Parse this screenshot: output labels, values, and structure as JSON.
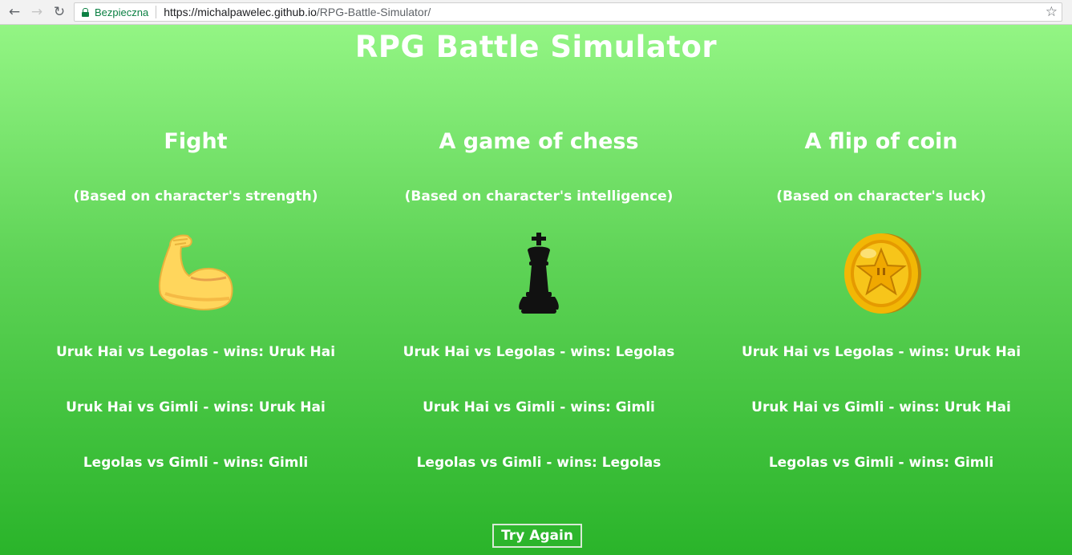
{
  "browser": {
    "secure_label": "Bezpieczna",
    "url_host": "https://michalpawelec.github.io",
    "url_path": "/RPG-Battle-Simulator/"
  },
  "page": {
    "title": "RPG Battle Simulator",
    "columns": [
      {
        "title": "Fight",
        "subtitle": "(Based on character's strength)",
        "icon": "flexed-biceps-icon",
        "results": [
          "Uruk Hai vs Legolas - wins: Uruk Hai",
          "Uruk Hai vs Gimli - wins: Uruk Hai",
          "Legolas vs Gimli - wins: Gimli"
        ]
      },
      {
        "title": "A game of chess",
        "subtitle": "(Based on character's intelligence)",
        "icon": "chess-king-icon",
        "results": [
          "Uruk Hai vs Legolas - wins: Legolas",
          "Uruk Hai vs Gimli - wins: Gimli",
          "Legolas vs Gimli - wins: Legolas"
        ]
      },
      {
        "title": "A flip of coin",
        "subtitle": "(Based on character's luck)",
        "icon": "gold-coin-icon",
        "results": [
          "Uruk Hai vs Legolas - wins: Uruk Hai",
          "Uruk Hai vs Gimli - wins: Uruk Hai",
          "Legolas vs Gimli - wins: Gimli"
        ]
      }
    ],
    "try_again_label": "Try Again"
  },
  "colors": {
    "secure_green": "#0b8043",
    "bg_top": "#93f584",
    "bg_bottom": "#2ab42a",
    "text": "#ffffff"
  }
}
